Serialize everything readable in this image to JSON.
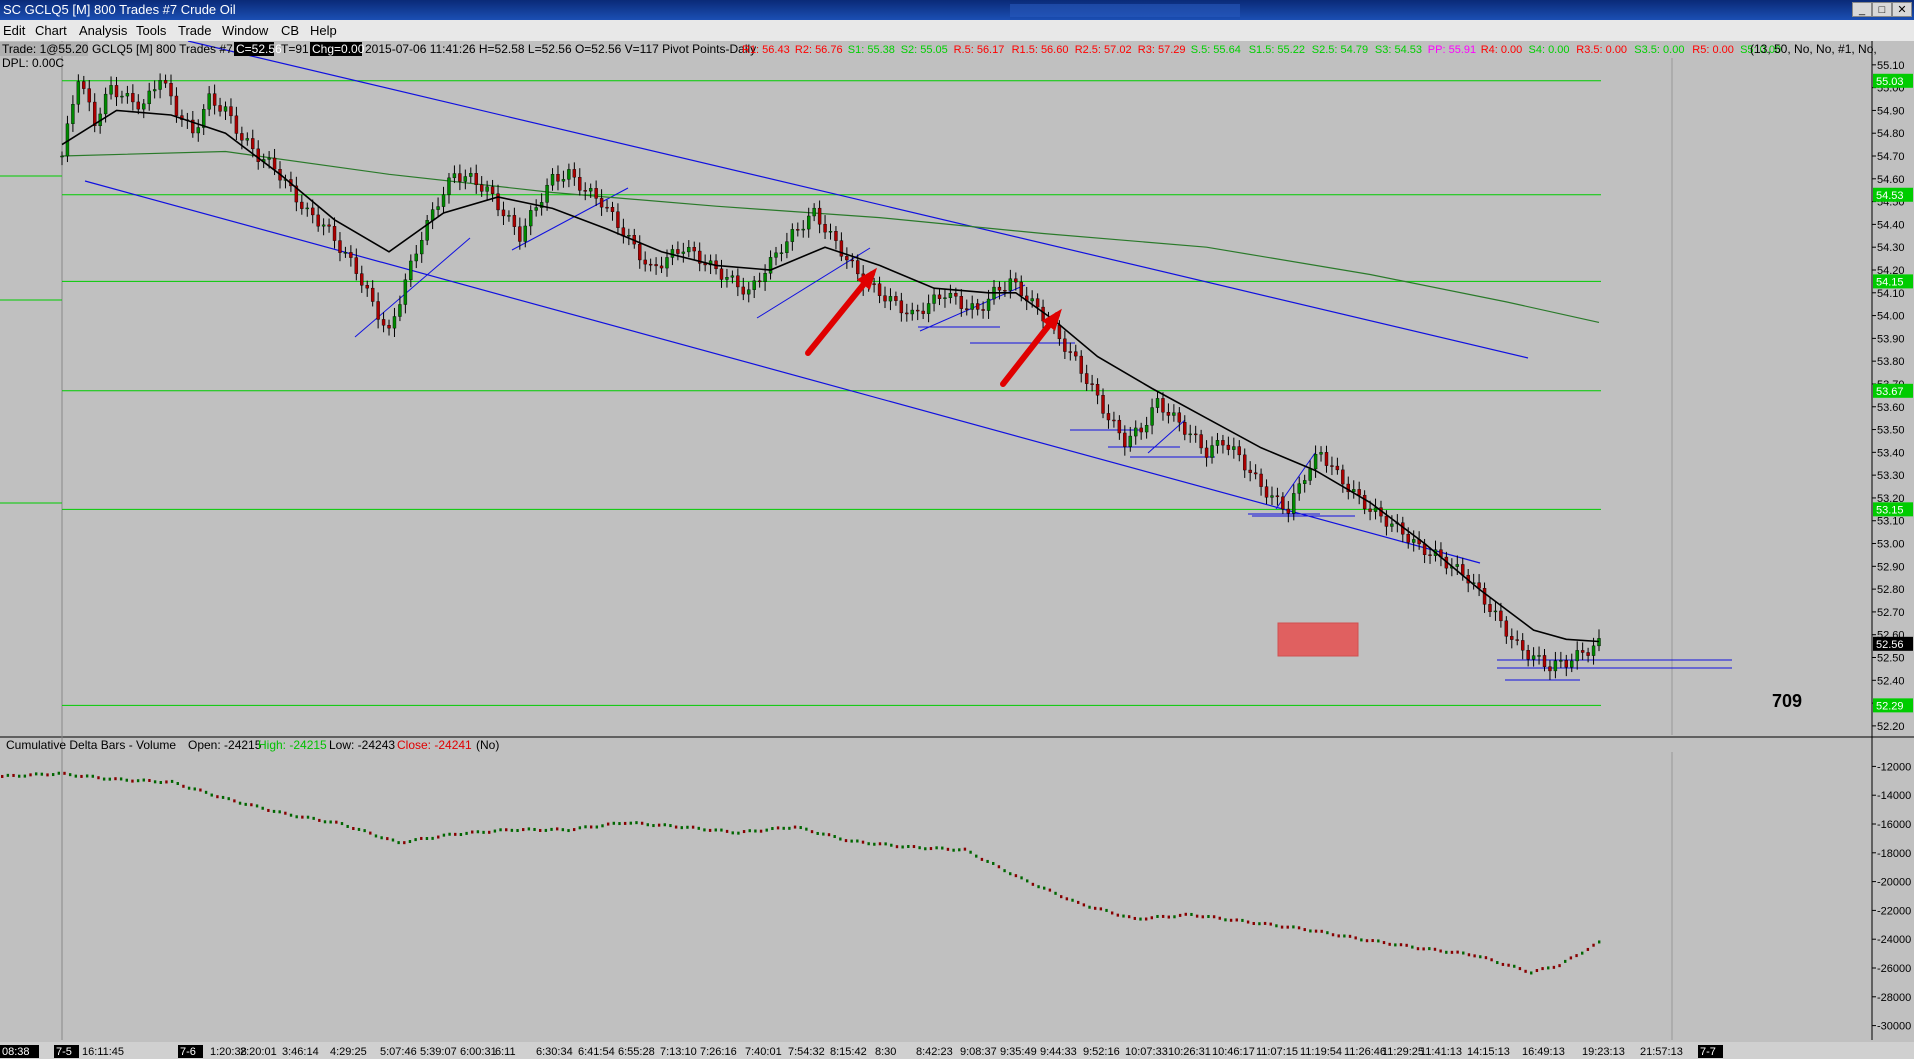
{
  "window": {
    "title": "SC GCLQ5 [M]  800 Trades  #7  Crude Oil",
    "controls": [
      "_",
      "□",
      "✕"
    ]
  },
  "menu": [
    "Edit",
    "Chart",
    "Analysis",
    "Tools",
    "Trade",
    "Window",
    "CB",
    "Help"
  ],
  "header": {
    "trade": "Trade: 1@55.20",
    "dpl": "DPL: 0.00C",
    "symbol": "GCLQ5 [M]  800 Trades  #7",
    "last_box": "C=52.56",
    "t_value": "T=91",
    "chg_box": "Chg=0.00",
    "ohlc": "2015-07-06 11:41:26 H=52.58 L=52.56 O=52.56 V=117 Pivot Points-Daily",
    "pivots": [
      {
        "label": "R1: 56.43",
        "color": "#ff0000"
      },
      {
        "label": "R2: 56.76",
        "color": "#ff0000"
      },
      {
        "label": "S1: 55.38",
        "color": "#00d000"
      },
      {
        "label": "S2: 55.05",
        "color": "#00d000"
      },
      {
        "label": "R.5: 56.17",
        "color": "#ff0000"
      },
      {
        "label": "R1.5: 56.60",
        "color": "#ff0000"
      },
      {
        "label": "R2.5: 57.02",
        "color": "#ff0000"
      },
      {
        "label": "R3: 57.29",
        "color": "#ff0000"
      },
      {
        "label": "S.5: 55.64",
        "color": "#00d000"
      },
      {
        "label": "S1.5: 55.22",
        "color": "#00d000"
      },
      {
        "label": "S2.5: 54.79",
        "color": "#00d000"
      },
      {
        "label": "S3: 54.53",
        "color": "#00d000"
      },
      {
        "label": "PP: 55.91",
        "color": "#ff00ff"
      },
      {
        "label": "R4: 0.00",
        "color": "#ff0000"
      },
      {
        "label": "S4: 0.00",
        "color": "#00d000"
      },
      {
        "label": "R3.5: 0.00",
        "color": "#ff0000"
      },
      {
        "label": "S3.5: 0.00",
        "color": "#00d000"
      },
      {
        "label": "R5: 0.00",
        "color": "#ff0000"
      },
      {
        "label": "S5: 0.00",
        "color": "#00d000"
      }
    ],
    "params": "(13, 50, No, No, #1, No,"
  },
  "annotation": "709",
  "lower_header": {
    "name": "Cumulative Delta Bars - Volume",
    "open": "Open: -24215",
    "high": "High: -24215",
    "low": "Low: -24243",
    "close": "Close: -24241",
    "flag": "(No)"
  },
  "chart_data": [
    {
      "type": "candlestick",
      "title": "GCLQ5 [M] 800 Trades #7 Crude Oil",
      "ylim": [
        52.16,
        55.13
      ],
      "y_ticks": [
        "55.10",
        "55.00",
        "54.90",
        "54.80",
        "54.70",
        "54.60",
        "54.50",
        "54.40",
        "54.30",
        "54.20",
        "54.10",
        "54.00",
        "53.90",
        "53.80",
        "53.70",
        "53.60",
        "53.50",
        "53.40",
        "53.30",
        "53.20",
        "53.10",
        "53.00",
        "52.90",
        "52.80",
        "52.70",
        "52.60",
        "52.50",
        "52.40",
        "52.30",
        "52.20"
      ],
      "price_markers": [
        {
          "label": "55.03",
          "value": 55.03
        },
        {
          "label": "54.53",
          "value": 54.53
        },
        {
          "label": "54.15",
          "value": 54.15
        },
        {
          "label": "53.67",
          "value": 53.67
        },
        {
          "label": "53.15",
          "value": 53.15
        },
        {
          "label": "52.56",
          "value": 52.56,
          "current": true
        },
        {
          "label": "52.29",
          "value": 52.29
        }
      ],
      "x_labels": [
        "08:38",
        "7-5",
        "16:11:45",
        "7-6",
        "1:20:38",
        "2:20:01",
        "3:46:14",
        "4:29:25",
        "5:07:46",
        "5:39:07",
        "6:00:31",
        "6:11",
        "6:30:34",
        "6:41:54",
        "6:55:28",
        "7:13:10",
        "7:26:16",
        "7:40:01",
        "7:54:32",
        "8:15:42",
        "8:30",
        "8:42:23",
        "9:08:37",
        "9:35:49",
        "9:44:33",
        "9:52:16",
        "10:07:33",
        "10:26:31",
        "10:46:17",
        "11:07:15",
        "11:19:54",
        "11:26:46",
        "11:29:25",
        "11:41:13",
        "14:15:13",
        "16:49:13",
        "19:23:13",
        "21:57:13",
        "7-7"
      ],
      "close_path": [
        [
          0,
          54.7
        ],
        [
          3,
          55.05
        ],
        [
          6,
          54.85
        ],
        [
          9,
          55.0
        ],
        [
          12,
          54.95
        ],
        [
          15,
          54.92
        ],
        [
          18,
          55.05
        ],
        [
          21,
          54.9
        ],
        [
          24,
          54.8
        ],
        [
          27,
          54.95
        ],
        [
          30,
          54.9
        ],
        [
          33,
          54.78
        ],
        [
          36,
          54.7
        ],
        [
          39,
          54.65
        ],
        [
          42,
          54.55
        ],
        [
          45,
          54.45
        ],
        [
          48,
          54.4
        ],
        [
          51,
          54.3
        ],
        [
          54,
          54.2
        ],
        [
          57,
          54.05
        ],
        [
          60,
          53.92
        ],
        [
          63,
          54.15
        ],
        [
          66,
          54.35
        ],
        [
          69,
          54.5
        ],
        [
          72,
          54.62
        ],
        [
          75,
          54.6
        ],
        [
          78,
          54.55
        ],
        [
          81,
          54.45
        ],
        [
          84,
          54.35
        ],
        [
          87,
          54.48
        ],
        [
          90,
          54.6
        ],
        [
          93,
          54.62
        ],
        [
          96,
          54.55
        ],
        [
          99,
          54.5
        ],
        [
          102,
          54.4
        ],
        [
          105,
          54.3
        ],
        [
          108,
          54.2
        ],
        [
          111,
          54.25
        ],
        [
          114,
          54.3
        ],
        [
          117,
          54.25
        ],
        [
          120,
          54.2
        ],
        [
          123,
          54.15
        ],
        [
          126,
          54.1
        ],
        [
          129,
          54.2
        ],
        [
          132,
          54.3
        ],
        [
          135,
          54.38
        ],
        [
          138,
          54.45
        ],
        [
          141,
          54.35
        ],
        [
          144,
          54.25
        ],
        [
          147,
          54.15
        ],
        [
          150,
          54.1
        ],
        [
          153,
          54.05
        ],
        [
          156,
          54.0
        ],
        [
          159,
          54.05
        ],
        [
          162,
          54.1
        ],
        [
          165,
          54.05
        ],
        [
          168,
          54.02
        ],
        [
          171,
          54.1
        ],
        [
          174,
          54.15
        ],
        [
          177,
          54.08
        ],
        [
          180,
          54.0
        ],
        [
          183,
          53.9
        ],
        [
          186,
          53.8
        ],
        [
          189,
          53.68
        ],
        [
          192,
          53.55
        ],
        [
          195,
          53.45
        ],
        [
          198,
          53.5
        ],
        [
          201,
          53.62
        ],
        [
          204,
          53.55
        ],
        [
          207,
          53.48
        ],
        [
          210,
          53.4
        ],
        [
          213,
          53.45
        ],
        [
          216,
          53.38
        ],
        [
          219,
          53.28
        ],
        [
          222,
          53.2
        ],
        [
          225,
          53.15
        ],
        [
          228,
          53.3
        ],
        [
          231,
          53.4
        ],
        [
          234,
          53.3
        ],
        [
          237,
          53.22
        ],
        [
          240,
          53.15
        ],
        [
          243,
          53.1
        ],
        [
          246,
          53.05
        ],
        [
          249,
          52.98
        ],
        [
          252,
          52.95
        ],
        [
          255,
          52.9
        ],
        [
          258,
          52.85
        ],
        [
          261,
          52.75
        ],
        [
          264,
          52.65
        ],
        [
          267,
          52.55
        ],
        [
          270,
          52.5
        ],
        [
          273,
          52.46
        ],
        [
          276,
          52.48
        ],
        [
          279,
          52.52
        ],
        [
          282,
          52.56
        ]
      ],
      "ema_fast": [
        [
          0,
          54.75
        ],
        [
          10,
          54.9
        ],
        [
          20,
          54.88
        ],
        [
          30,
          54.8
        ],
        [
          40,
          54.62
        ],
        [
          50,
          54.42
        ],
        [
          60,
          54.28
        ],
        [
          70,
          54.45
        ],
        [
          80,
          54.52
        ],
        [
          90,
          54.47
        ],
        [
          100,
          54.38
        ],
        [
          110,
          54.28
        ],
        [
          120,
          54.22
        ],
        [
          130,
          54.2
        ],
        [
          140,
          54.3
        ],
        [
          150,
          54.22
        ],
        [
          160,
          54.12
        ],
        [
          170,
          54.1
        ],
        [
          175,
          54.1
        ],
        [
          182,
          53.98
        ],
        [
          190,
          53.82
        ],
        [
          200,
          53.68
        ],
        [
          210,
          53.55
        ],
        [
          220,
          53.42
        ],
        [
          230,
          53.32
        ],
        [
          240,
          53.18
        ],
        [
          250,
          53.0
        ],
        [
          260,
          52.8
        ],
        [
          270,
          52.62
        ],
        [
          276,
          52.58
        ],
        [
          282,
          52.57
        ]
      ],
      "ma_slow": [
        [
          0,
          54.7
        ],
        [
          30,
          54.72
        ],
        [
          60,
          54.62
        ],
        [
          90,
          54.54
        ],
        [
          120,
          54.48
        ],
        [
          150,
          54.43
        ],
        [
          180,
          54.36
        ],
        [
          210,
          54.3
        ],
        [
          240,
          54.18
        ],
        [
          265,
          54.06
        ],
        [
          282,
          53.97
        ]
      ],
      "horizontal_levels": [
        55.03,
        54.53,
        54.15,
        53.67,
        53.15,
        52.29
      ],
      "trendlines": [
        {
          "from": [
            188,
            41
          ],
          "to": [
            1528,
            358
          ]
        },
        {
          "from": [
            85,
            181
          ],
          "to": [
            1480,
            563
          ]
        }
      ],
      "arrows": 2,
      "highlight_box": "red"
    },
    {
      "type": "cumulative_delta_bars",
      "title": "Cumulative Delta Bars - Volume",
      "ylim": [
        -31000,
        -11000
      ],
      "y_ticks": [
        "-12000",
        "-14000",
        "-16000",
        "-18000",
        "-20000",
        "-22000",
        "-24000",
        "-26000",
        "-28000",
        "-30000"
      ],
      "path": [
        [
          0,
          -12700
        ],
        [
          10,
          -12500
        ],
        [
          20,
          -12900
        ],
        [
          30,
          -13100
        ],
        [
          40,
          -14300
        ],
        [
          50,
          -15300
        ],
        [
          60,
          -16000
        ],
        [
          70,
          -17300
        ],
        [
          80,
          -16700
        ],
        [
          90,
          -16400
        ],
        [
          100,
          -16400
        ],
        [
          110,
          -15900
        ],
        [
          120,
          -16200
        ],
        [
          130,
          -16600
        ],
        [
          140,
          -16200
        ],
        [
          150,
          -17200
        ],
        [
          160,
          -17600
        ],
        [
          170,
          -17800
        ],
        [
          180,
          -19800
        ],
        [
          190,
          -21500
        ],
        [
          200,
          -22600
        ],
        [
          210,
          -22300
        ],
        [
          220,
          -22800
        ],
        [
          230,
          -23300
        ],
        [
          240,
          -24000
        ],
        [
          250,
          -24600
        ],
        [
          260,
          -25100
        ],
        [
          270,
          -26300
        ],
        [
          275,
          -25800
        ],
        [
          282,
          -24241
        ]
      ]
    }
  ]
}
